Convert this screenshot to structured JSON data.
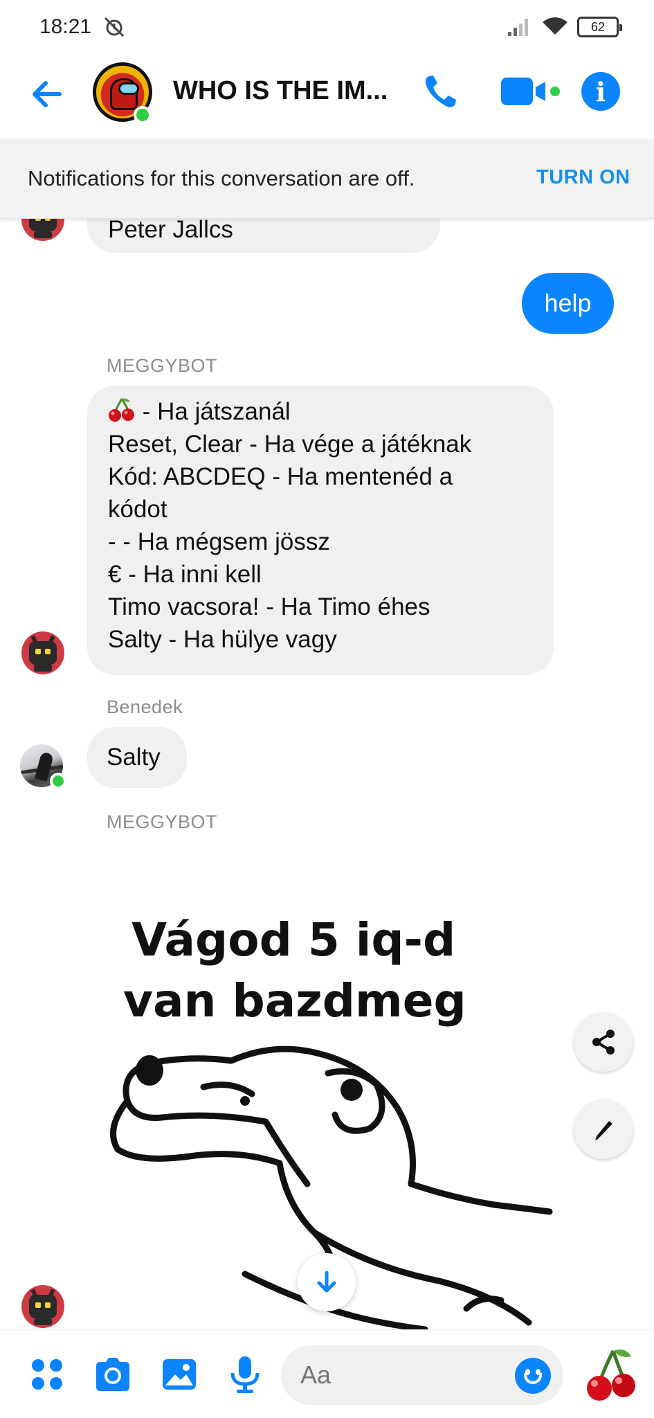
{
  "status_bar": {
    "time": "18:21",
    "battery": "62",
    "alarm_icon": "alarm-off-icon",
    "signal_icon": "signal-icon",
    "wifi_icon": "wifi-icon"
  },
  "header": {
    "title": "WHO IS THE IM...",
    "back_icon": "arrow-left-icon",
    "call_icon": "phone-icon",
    "video_icon": "video-camera-icon",
    "info_icon": "info-icon",
    "info_glyph": "i",
    "online": true
  },
  "notification": {
    "text": "Notifications for this conversation are off.",
    "action": "TURN ON"
  },
  "messages": {
    "prev_bubble_text": "Peter Jallcs",
    "outgoing_help": "help",
    "bot_name_1": "MEGGYBOT",
    "bot_help_lines": [
      " - Ha játszanál",
      "Reset, Clear - Ha vége a játéknak",
      "Kód: ABCDEQ - Ha mentenéd a",
      "kódot",
      "- - Ha mégsem jössz",
      "€ - Ha inni kell",
      "Timo vacsora! - Ha Timo éhes",
      "Salty - Ha hülye vagy"
    ],
    "benedek_name": "Benedek",
    "benedek_text": "Salty",
    "bot_name_2": "MEGGYBOT",
    "meme_line_1": "Vágod 5 iq-d",
    "meme_line_2": "van bazdmeg"
  },
  "floating": {
    "share_icon": "share-icon",
    "edit_icon": "pencil-icon",
    "scroll_icon": "arrow-down-icon"
  },
  "composer": {
    "placeholder": "Aa",
    "menu_icon": "four-dots-menu-icon",
    "camera_icon": "camera-icon",
    "gallery_icon": "image-icon",
    "mic_icon": "microphone-icon",
    "emoji_icon": "smiley-icon",
    "quick_reaction_icon": "cherry-icon"
  },
  "colors": {
    "accent": "#0a84ff",
    "online": "#31cc46",
    "bubble_in": "#f0f0f0",
    "turn_on": "#1590e6"
  }
}
